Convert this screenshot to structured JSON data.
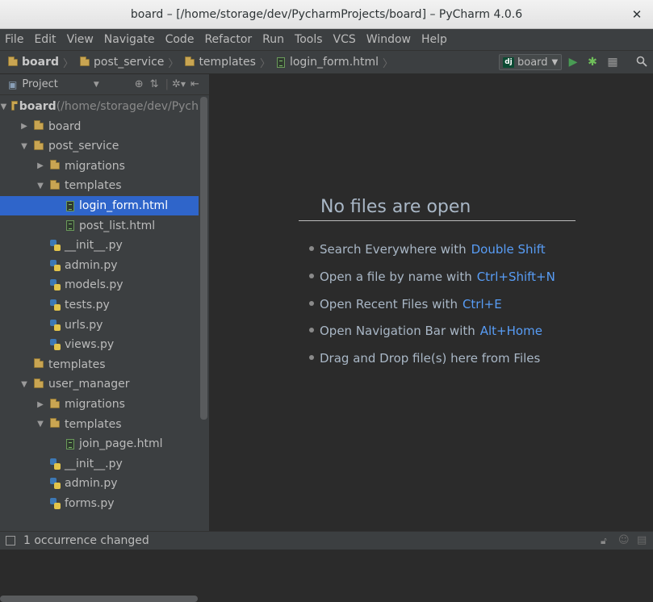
{
  "window": {
    "title": "board – [/home/storage/dev/PycharmProjects/board] – PyCharm 4.0.6"
  },
  "menu": [
    "File",
    "Edit",
    "View",
    "Navigate",
    "Code",
    "Refactor",
    "Run",
    "Tools",
    "VCS",
    "Window",
    "Help"
  ],
  "breadcrumbs": [
    "board",
    "post_service",
    "templates",
    "login_form.html"
  ],
  "run_config": {
    "badge": "dj",
    "label": "board"
  },
  "project_panel": {
    "title": "Project"
  },
  "tree": [
    {
      "label": "board",
      "suffix": " (/home/storage/dev/Pych",
      "type": "folder",
      "depth": 0,
      "arrow": "down",
      "bold": true
    },
    {
      "label": "board",
      "type": "folder",
      "depth": 1,
      "arrow": "right"
    },
    {
      "label": "post_service",
      "type": "folder",
      "depth": 1,
      "arrow": "down"
    },
    {
      "label": "migrations",
      "type": "folder",
      "depth": 2,
      "arrow": "right"
    },
    {
      "label": "templates",
      "type": "folder",
      "depth": 2,
      "arrow": "down"
    },
    {
      "label": "login_form.html",
      "type": "html",
      "depth": 3,
      "selected": true
    },
    {
      "label": "post_list.html",
      "type": "html",
      "depth": 3
    },
    {
      "label": "__init__.py",
      "type": "py",
      "depth": 2
    },
    {
      "label": "admin.py",
      "type": "py",
      "depth": 2
    },
    {
      "label": "models.py",
      "type": "py",
      "depth": 2
    },
    {
      "label": "tests.py",
      "type": "py",
      "depth": 2
    },
    {
      "label": "urls.py",
      "type": "py",
      "depth": 2
    },
    {
      "label": "views.py",
      "type": "py",
      "depth": 2
    },
    {
      "label": "templates",
      "type": "folder",
      "depth": 1
    },
    {
      "label": "user_manager",
      "type": "folder",
      "depth": 1,
      "arrow": "down"
    },
    {
      "label": "migrations",
      "type": "folder",
      "depth": 2,
      "arrow": "right"
    },
    {
      "label": "templates",
      "type": "folder",
      "depth": 2,
      "arrow": "down"
    },
    {
      "label": "join_page.html",
      "type": "html",
      "depth": 3
    },
    {
      "label": "__init__.py",
      "type": "py",
      "depth": 2
    },
    {
      "label": "admin.py",
      "type": "py",
      "depth": 2
    },
    {
      "label": "forms.py",
      "type": "py",
      "depth": 2
    }
  ],
  "editor": {
    "empty_title": "No files are open",
    "hints": [
      {
        "text": "Search Everywhere with",
        "key": "Double Shift"
      },
      {
        "text": "Open a file by name with",
        "key": "Ctrl+Shift+N"
      },
      {
        "text": "Open Recent Files with",
        "key": "Ctrl+E"
      },
      {
        "text": "Open Navigation Bar with",
        "key": "Alt+Home"
      },
      {
        "text": "Drag and Drop file(s) here from Files",
        "key": ""
      }
    ]
  },
  "status": {
    "message": "1 occurrence changed"
  },
  "colors": {
    "accent": "#2f65ca",
    "shortcut": "#589df6",
    "run": "#499c54"
  }
}
